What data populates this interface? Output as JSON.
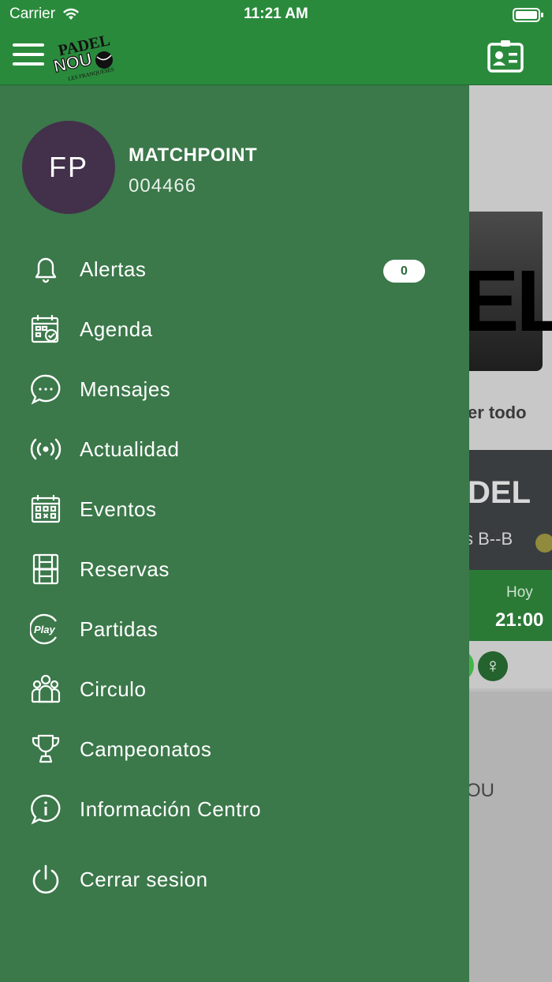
{
  "status_bar": {
    "carrier": "Carrier",
    "time": "11:21 AM"
  },
  "app_bar": {
    "logo_text": "PADEL NOU",
    "logo_subtext": "LES FRANQUESES"
  },
  "user": {
    "initials": "FP",
    "name": "MATCHPOINT",
    "id": "004466"
  },
  "menu": {
    "items": [
      {
        "label": "Alertas",
        "icon": "bell-icon"
      },
      {
        "label": "Agenda",
        "icon": "calendar-check-icon"
      },
      {
        "label": "Mensajes",
        "icon": "chat-bubble-icon"
      },
      {
        "label": "Actualidad",
        "icon": "broadcast-icon"
      },
      {
        "label": "Eventos",
        "icon": "calendar-grid-icon"
      },
      {
        "label": "Reservas",
        "icon": "court-icon"
      },
      {
        "label": "Partidas",
        "icon": "play-icon"
      },
      {
        "label": "Circulo",
        "icon": "group-icon"
      },
      {
        "label": "Campeonatos",
        "icon": "trophy-icon"
      },
      {
        "label": "Información Centro",
        "icon": "info-bubble-icon"
      },
      {
        "label": "Cerrar sesion",
        "icon": "power-icon"
      }
    ],
    "alerts_count": "0"
  },
  "background": {
    "banner_text": "EL",
    "see_all": "er todo",
    "card_title": "DEL",
    "card_subtitle": "s B--B",
    "day": "Hoy",
    "hour": "21:00",
    "lower_text": "OU"
  },
  "colors": {
    "header": "#2a8a3c",
    "drawer": "#3b784a",
    "avatar": "#43304a"
  }
}
